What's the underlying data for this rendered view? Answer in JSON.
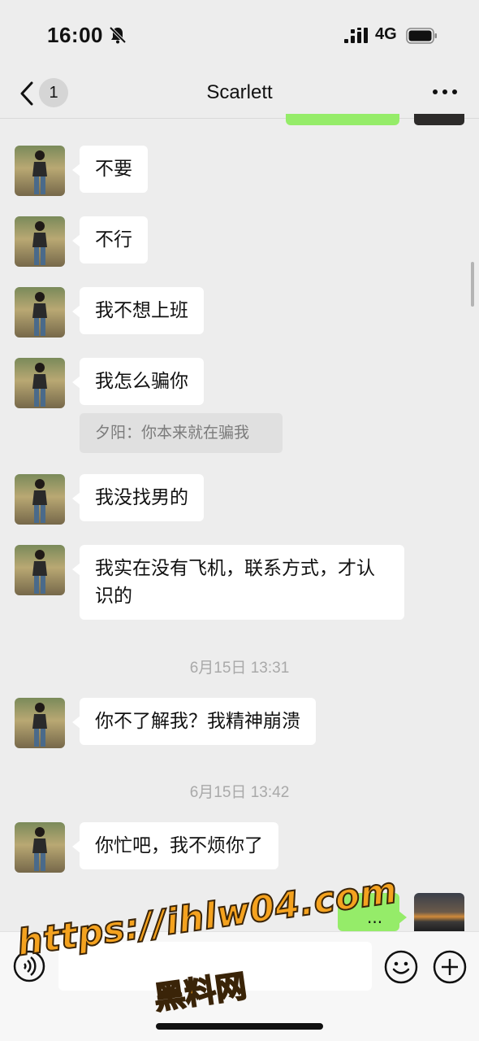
{
  "status_bar": {
    "time": "16:00",
    "network": "4G"
  },
  "nav": {
    "unread_count": "1",
    "title": "Scarlett"
  },
  "messages": [
    {
      "text": "不要"
    },
    {
      "text": "不行"
    },
    {
      "text": "我不想上班"
    },
    {
      "text": "我怎么骗你"
    },
    {
      "text": "我没找男的"
    },
    {
      "text": "我实在没有飞机，联系方式，才认识的"
    },
    {
      "text": "你不了解我？我精神崩溃"
    },
    {
      "text": "你忙吧，我不烦你了"
    }
  ],
  "quote": {
    "text": "夕阳：你本来就在骗我"
  },
  "timestamps": [
    "6月15日 13:31",
    "6月15日 13:42"
  ],
  "outgoing": {
    "text": "..."
  },
  "watermark": {
    "url": "https://ihlw04.com",
    "name": "黑料网"
  },
  "colors": {
    "background": "#ededed",
    "outgoing_bubble": "#95ec69",
    "incoming_bubble": "#ffffff",
    "watermark": "#f4a21f"
  },
  "icons": [
    "bell-off-icon",
    "signal-icon",
    "battery-icon",
    "back-icon",
    "more-icon",
    "voice-icon",
    "emoji-icon",
    "plus-icon"
  ]
}
